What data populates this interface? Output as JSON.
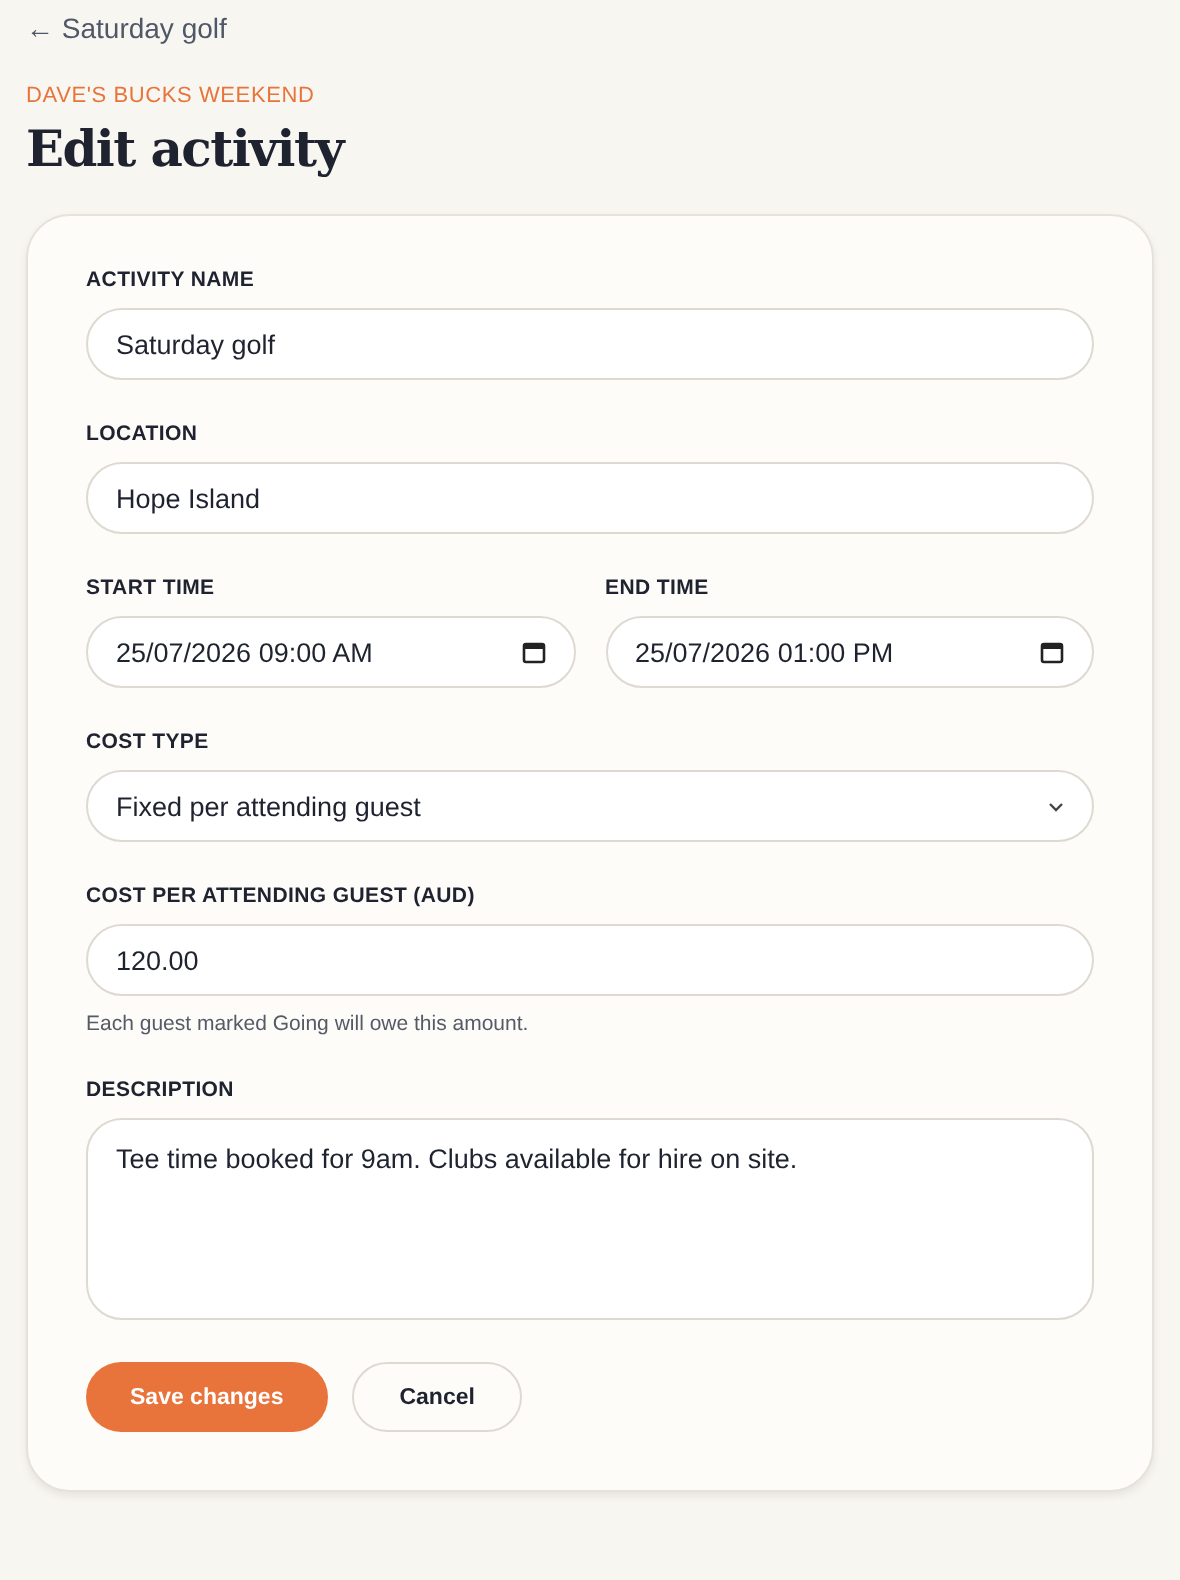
{
  "back_link": "← Saturday golf",
  "eyebrow": "DAVE'S BUCKS WEEKEND",
  "title": "Edit activity",
  "rows": [
    [
      {
        "kind": "text",
        "label": "ACTIVITY NAME",
        "value": "Saturday golf"
      }
    ],
    [
      {
        "kind": "text",
        "label": "LOCATION",
        "value": "Hope Island"
      }
    ],
    [
      {
        "kind": "datetime",
        "label": "START TIME",
        "value": "25/07/2026 09:00 AM"
      },
      {
        "kind": "datetime",
        "label": "END TIME",
        "value": "25/07/2026 01:00 PM"
      }
    ],
    [
      {
        "kind": "select",
        "label": "COST TYPE",
        "value": "Fixed per attending guest"
      }
    ],
    [
      {
        "kind": "text",
        "label": "COST PER ATTENDING GUEST (AUD)",
        "value": "120.00",
        "hint": "Each guest marked Going will owe this amount."
      }
    ],
    [
      {
        "kind": "textarea",
        "label": "DESCRIPTION",
        "value": "Tee time booked for 9am. Clubs available for hire on site."
      }
    ]
  ],
  "buttons": [
    {
      "label": "Save changes",
      "kind": "primary"
    },
    {
      "label": "Cancel",
      "kind": "secondary"
    }
  ]
}
